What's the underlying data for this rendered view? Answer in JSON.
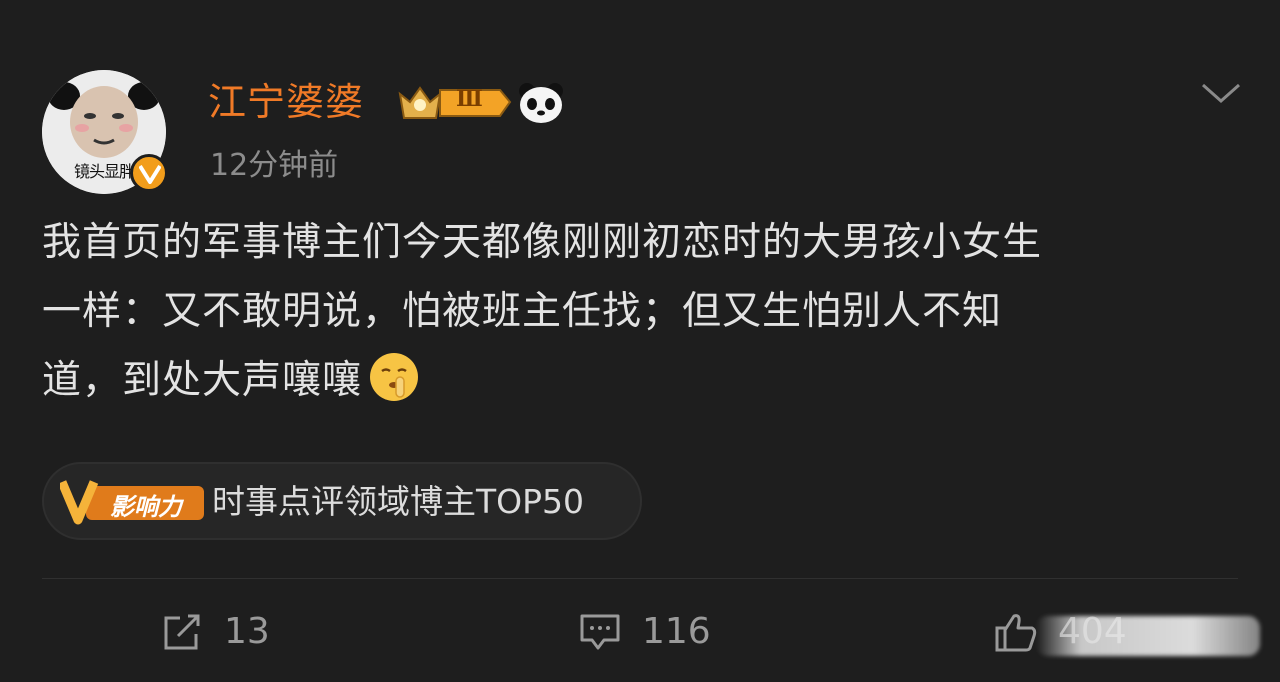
{
  "post": {
    "author": {
      "name": "江宁婆婆",
      "avatar_caption": "镜头显胖",
      "level_badge": "Ⅲ"
    },
    "timestamp": "12分钟前",
    "content_lines": [
      "我首页的军事博主们今天都像刚刚初恋时的大男孩小女生",
      "一样：又不敢明说，怕被班主任找；但又生怕别人不知",
      "道，到处大声嚷嚷"
    ],
    "influence": {
      "badge_label": "影响力",
      "text": "时事点评领域博主TOP50"
    },
    "actions": {
      "repost_count": "13",
      "comment_count": "116",
      "like_count": "404"
    }
  },
  "colors": {
    "background": "#1e1e1e",
    "username": "#f07a27",
    "text": "#e3e3e3",
    "muted": "#8c8c8c",
    "badge_orange": "#f29d1b"
  },
  "icons": [
    "avatar-image",
    "verified-v-icon",
    "level-crown-badge",
    "panda-icon",
    "chevron-down-icon",
    "shush-emoji-icon",
    "influence-v-icon",
    "repost-icon",
    "comment-icon",
    "like-thumb-icon"
  ]
}
